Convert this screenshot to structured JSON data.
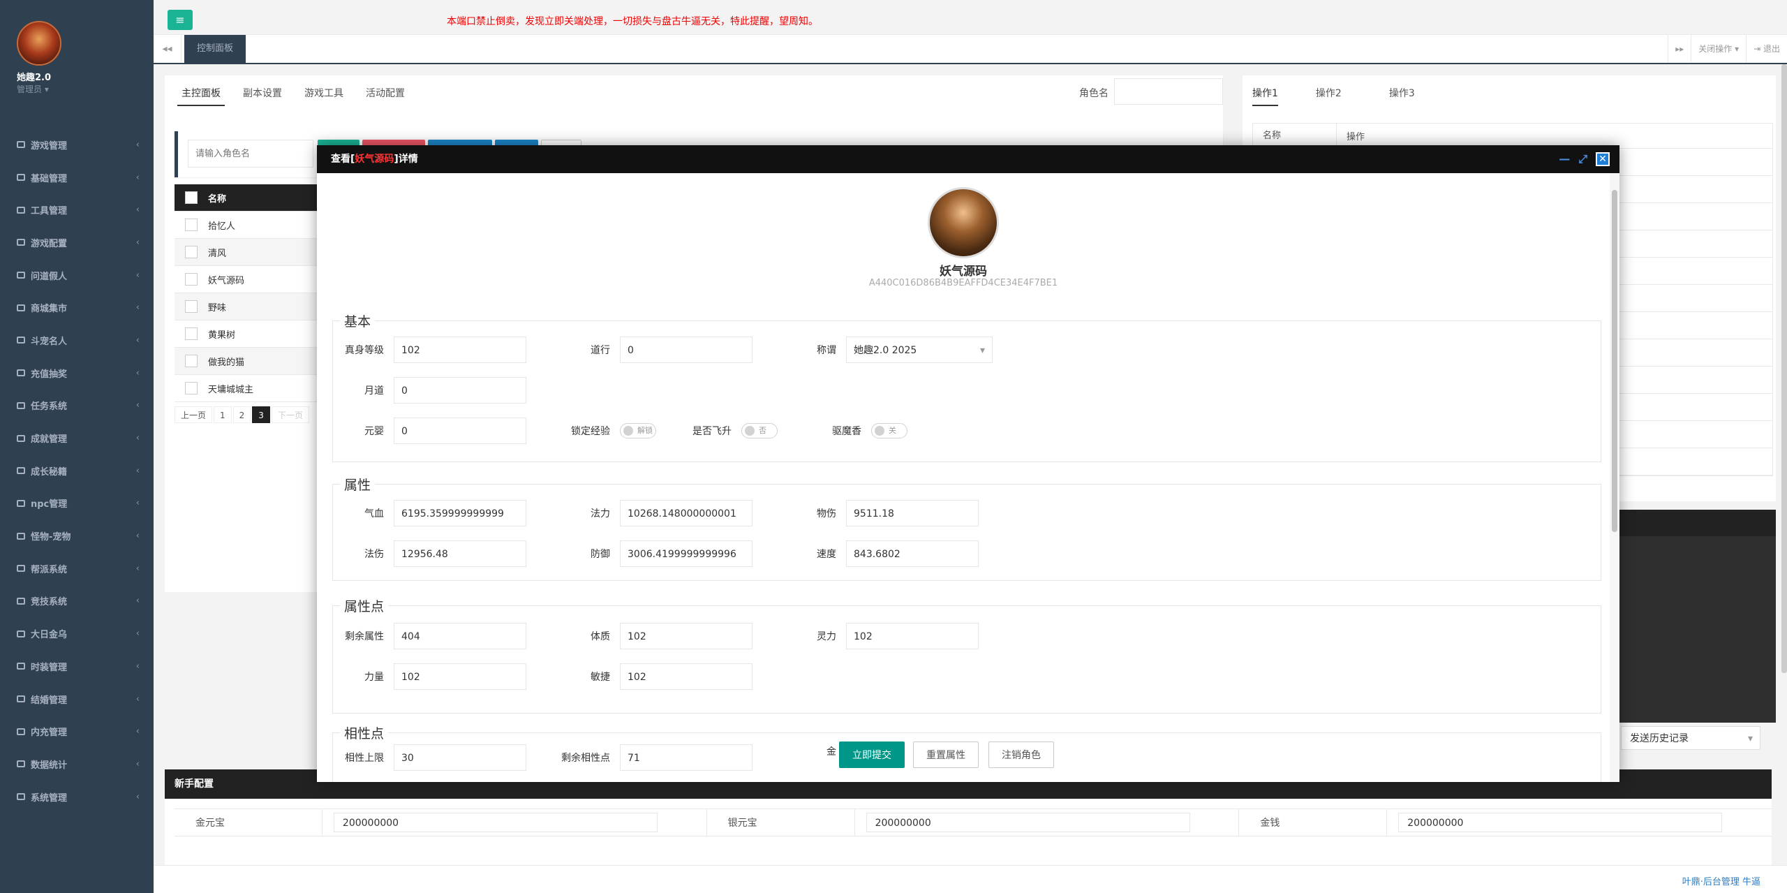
{
  "profile": {
    "name": "她趣2.0",
    "role": "管理员"
  },
  "sidebar": {
    "items": [
      {
        "label": "游戏管理",
        "icon": "link-icon"
      },
      {
        "label": "基础管理",
        "icon": "cutlery-icon"
      },
      {
        "label": "工具管理",
        "icon": "cutlery-icon"
      },
      {
        "label": "游戏配置",
        "icon": "table-icon"
      },
      {
        "label": "问道假人",
        "icon": "user-icon"
      },
      {
        "label": "商城集市",
        "icon": "gear-icon"
      },
      {
        "label": "斗宠名人",
        "icon": "rocket-icon"
      },
      {
        "label": "充值抽奖",
        "icon": "money-icon"
      },
      {
        "label": "任务系统",
        "icon": "gear-icon"
      },
      {
        "label": "成就管理",
        "icon": "gear-icon"
      },
      {
        "label": "成长秘籍",
        "icon": "money-icon"
      },
      {
        "label": "npc管理",
        "icon": "square-icon"
      },
      {
        "label": "怪物-宠物",
        "icon": "half-circle-icon"
      },
      {
        "label": "帮派系统",
        "icon": "table-icon"
      },
      {
        "label": "竞技系统",
        "icon": "gears-icon"
      },
      {
        "label": "大日金乌",
        "icon": "gears-icon"
      },
      {
        "label": "时装管理",
        "icon": "bicycle-icon"
      },
      {
        "label": "结婚管理",
        "icon": "book-icon"
      },
      {
        "label": "内充管理",
        "icon": "desktop-icon"
      },
      {
        "label": "数据统计",
        "icon": "database-icon"
      },
      {
        "label": "系统管理",
        "icon": "desktop-icon"
      }
    ]
  },
  "header": {
    "notice": "本端口禁止倒卖，发现立即关端处理，一切损失与盘古牛逼无关，特此提醒，望周知。"
  },
  "tabs": {
    "current": "控制面板",
    "close_ops": "关闭操作",
    "logout": "退出"
  },
  "main": {
    "subtabs": [
      "主控面板",
      "副本设置",
      "游戏工具",
      "活动配置"
    ],
    "role_label": "角色名",
    "search_placeholder": "请输入角色名",
    "table_header": "名称",
    "rows": [
      "拾忆人",
      "清风",
      "妖气源码",
      "野味",
      "黄果树",
      "做我的猫",
      "天墉城城主"
    ],
    "pager": {
      "prev": "上一页",
      "pages": [
        "1",
        "2",
        "3"
      ],
      "next": "下一页"
    }
  },
  "right": {
    "tabs": [
      "操作1",
      "操作2",
      "操作3"
    ],
    "col_name": "名称",
    "col_op": "操作",
    "history": "发送历史记录"
  },
  "newbie": {
    "title": "新手配置",
    "rows": [
      [
        {
          "label": "金元宝",
          "value": "200000000"
        },
        {
          "label": "银元宝",
          "value": "200000000"
        },
        {
          "label": "金钱",
          "value": "200000000"
        }
      ]
    ]
  },
  "footer": "叶鼎·后台管理 牛逼",
  "modal": {
    "title_pre": "查看[",
    "title_name": "妖气源码",
    "title_post": "]详情",
    "hero_name": "妖气源码",
    "hero_id": "A440C016D86B4B9EAFFD4CE34E4F7BE1",
    "sections": {
      "basic": "基本",
      "attr": "属性",
      "points": "属性点",
      "affinity": "相性点"
    },
    "basic": {
      "level_label": "真身等级",
      "level": "102",
      "dao_label": "道行",
      "dao": "0",
      "title_label": "称谓",
      "title_value": "她趣2.0 2025",
      "moon_label": "月道",
      "moon": "0",
      "yuanying_label": "元婴",
      "yuanying": "0",
      "lockexp_label": "锁定经验",
      "lockexp": "解锁",
      "fly_label": "是否飞升",
      "fly": "否",
      "incense_label": "驱魔香",
      "incense": "关"
    },
    "attr": {
      "hp_label": "气血",
      "hp": "6195.359999999999",
      "mp_label": "法力",
      "mp": "10268.148000000001",
      "phy_label": "物伤",
      "phy": "9511.18",
      "mag_label": "法伤",
      "mag": "12956.48",
      "def_label": "防御",
      "def": "3006.4199999999996",
      "spd_label": "速度",
      "spd": "843.6802"
    },
    "points": {
      "remain_label": "剩余属性",
      "remain": "404",
      "con_label": "体质",
      "con": "102",
      "spi_label": "灵力",
      "spi": "102",
      "str_label": "力量",
      "str": "102",
      "agi_label": "敏捷",
      "agi": "102"
    },
    "affinity": {
      "cap_label": "相性上限",
      "cap": "30",
      "remain_label": "剩余相性点",
      "remain": "71",
      "gold_label": "金"
    },
    "buttons": {
      "submit": "立即提交",
      "reset": "重置属性",
      "delete": "注销角色"
    }
  }
}
